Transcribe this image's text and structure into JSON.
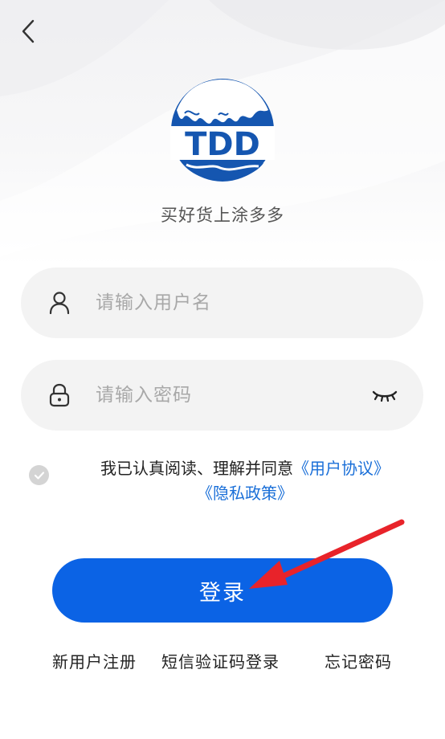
{
  "brand": {
    "logo_text": "TDD",
    "slogan": "买好货上涂多多",
    "accent_color": "#0b63e5",
    "link_color": "#1a6fd8"
  },
  "form": {
    "username_placeholder": "请输入用户名",
    "password_placeholder": "请输入密码",
    "username_icon": "user-icon",
    "password_icon": "lock-icon",
    "visibility_icon": "eye-closed-icon"
  },
  "agreement": {
    "prefix": "我已认真阅读、理解并同意",
    "user_agreement": "《用户协议》",
    "privacy_policy": "《隐私政策》",
    "checked": false
  },
  "actions": {
    "login_label": "登录",
    "register_label": "新用户注册",
    "sms_login_label": "短信验证码登录",
    "forgot_password_label": "忘记密码"
  }
}
